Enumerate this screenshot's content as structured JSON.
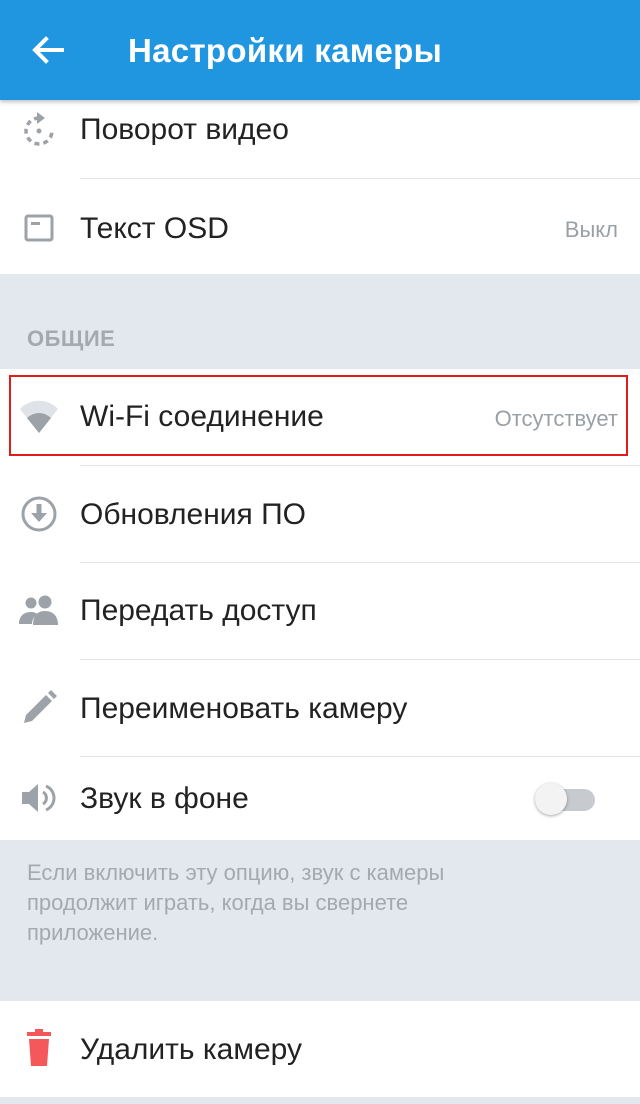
{
  "appbar": {
    "back_icon": "arrow-left-icon",
    "title": "Настройки камеры"
  },
  "video": {
    "rotation": {
      "icon": "rotate-icon",
      "label": "Поворот видео"
    },
    "osd": {
      "icon": "osd-text-icon",
      "label": "Текст OSD",
      "value": "Выкл"
    }
  },
  "general": {
    "header": "ОБЩИЕ",
    "wifi": {
      "icon": "wifi-icon",
      "label": "Wi-Fi соединение",
      "value": "Отсутствует"
    },
    "updates": {
      "icon": "download-circle-icon",
      "label": "Обновления ПО"
    },
    "share": {
      "icon": "people-icon",
      "label": "Передать доступ"
    },
    "rename": {
      "icon": "pencil-icon",
      "label": "Переименовать камеру"
    },
    "background_sound": {
      "icon": "speaker-icon",
      "label": "Звук в фоне",
      "enabled": false
    },
    "hint": "Если включить эту опцию, звук с камеры продолжит играть, когда вы свернете приложение."
  },
  "delete": {
    "icon": "trash-icon",
    "label": "Удалить камеру"
  },
  "colors": {
    "appbar": "#2196e0",
    "background": "#e3e7ee",
    "highlight": "#e31a1a",
    "delete_icon": "#f4585a",
    "icon_gray": "#9da2a8"
  }
}
